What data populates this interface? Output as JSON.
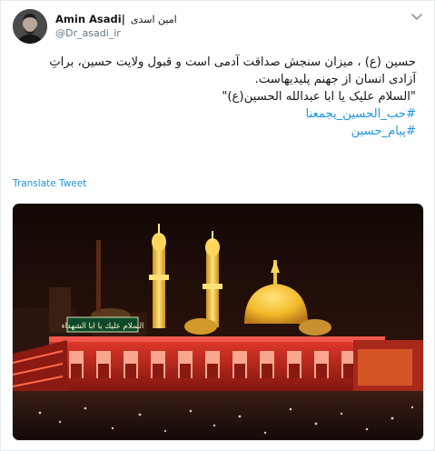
{
  "tweet": {
    "display_name": "Amin Asadi|",
    "display_name_fa": "امین اسدی",
    "handle": "@Dr_asadi_ir",
    "text_lines": [
      "حسین (ع) ، میزان سنجش صداقت آدمی است و قبول ولایت حسین، براتِ",
      "آزادی انسان از جهنم پلیدیهاست.",
      "\"السلام علیک یا ابا عبدالله الحسین(ع)\""
    ],
    "hashtags": [
      "#حب_الحسين_يجمعنا",
      "#پیام_حسین"
    ],
    "translate_label": "Translate Tweet"
  },
  "photo": {
    "banner_text": "السلام عليك يا ابا الشهداء"
  },
  "icons": {
    "menu": "chevron-down-icon"
  },
  "colors": {
    "link": "#1b95e0",
    "handle": "#657786",
    "dome_gold": "#f2c23a",
    "night_sky": "#1a0d08",
    "shrine_red": "#c9281c"
  }
}
